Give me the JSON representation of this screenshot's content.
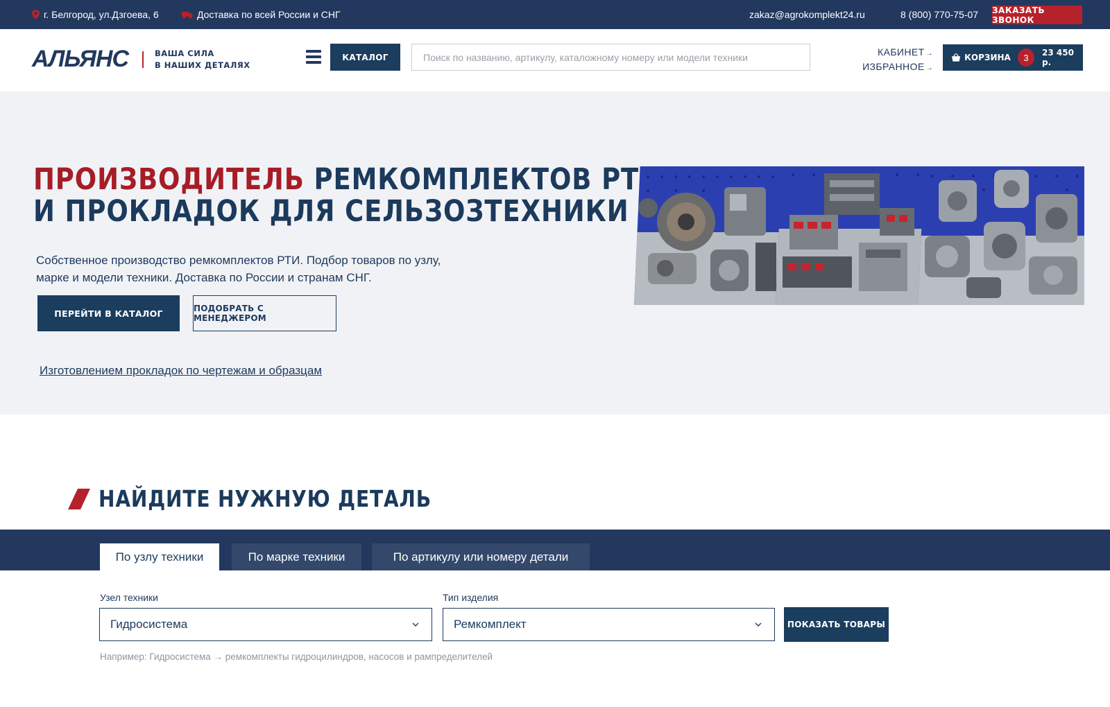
{
  "topbar": {
    "address": "г. Белгород, ул.Дзгоева, 6",
    "delivery": "Доставка по всей России и СНГ",
    "email": "zakaz@agrokomplekt24.ru",
    "phone": "8 (800) 770-75-07",
    "call_button": "ЗАКАЗАТЬ ЗВОНОК"
  },
  "header": {
    "logo_text": "АЛЬЯНС",
    "tagline_line1": "ВАША СИЛА",
    "tagline_line2": "В НАШИХ ДЕТАЛЯХ",
    "catalog_button": "КАТАЛОГ",
    "search_placeholder": "Поиск по названию, артикулу, каталожному номеру или модели техники",
    "cabinet_link": "КАБИНЕТ",
    "favorites_link": "ИЗБРАННОЕ",
    "cart_label": "КОРЗИНА",
    "cart_count": "3",
    "cart_total": "23 450 р."
  },
  "hero": {
    "title_accent": "ПРОИЗВОДИТЕЛЬ",
    "title_rest_line1": "РЕМКОМПЛЕКТОВ РТИ",
    "title_line2": "И ПРОКЛАДОК ДЛЯ СЕЛЬЗОЗТЕХНИКИ",
    "description": "Собственное производство ремкомплектов РТИ. Подбор товаров по узлу, марке и модели техники. Доставка по России и странам СНГ.",
    "primary_button": "ПЕРЕЙТИ В КАТАЛОГ",
    "secondary_button": "ПОДОБРАТЬ С МЕНЕДЖЕРОМ",
    "link": "Изготовлением прокладок по чертежам и образцам"
  },
  "find": {
    "title": "НАЙДИТЕ НУЖНУЮ ДЕТАЛЬ",
    "tabs": [
      {
        "label": "По узлу техники"
      },
      {
        "label": "По марке техники"
      },
      {
        "label": "По артикулу или номеру детали"
      }
    ],
    "node_label": "Узел техники",
    "node_value": "Гидросистема",
    "type_label": "Тип изделия",
    "type_value": "Ремкомплект",
    "show_button": "ПОКАЗАТЬ ТОВАРЫ",
    "hint": "Например: Гидросистема → ремкомплекты гидроцилиндров, насосов и рампределителей"
  },
  "colors": {
    "navy": "#22385e",
    "button_navy": "#1b3d5e",
    "accent_red": "#b6222c",
    "hero_bg": "#f1f2f6"
  },
  "icons": {
    "address": "map-pin-icon",
    "delivery": "truck-icon",
    "menu": "hamburger-icon",
    "cart": "basket-icon",
    "select": "chevron-down-icon",
    "section": "slash-mark-icon"
  }
}
